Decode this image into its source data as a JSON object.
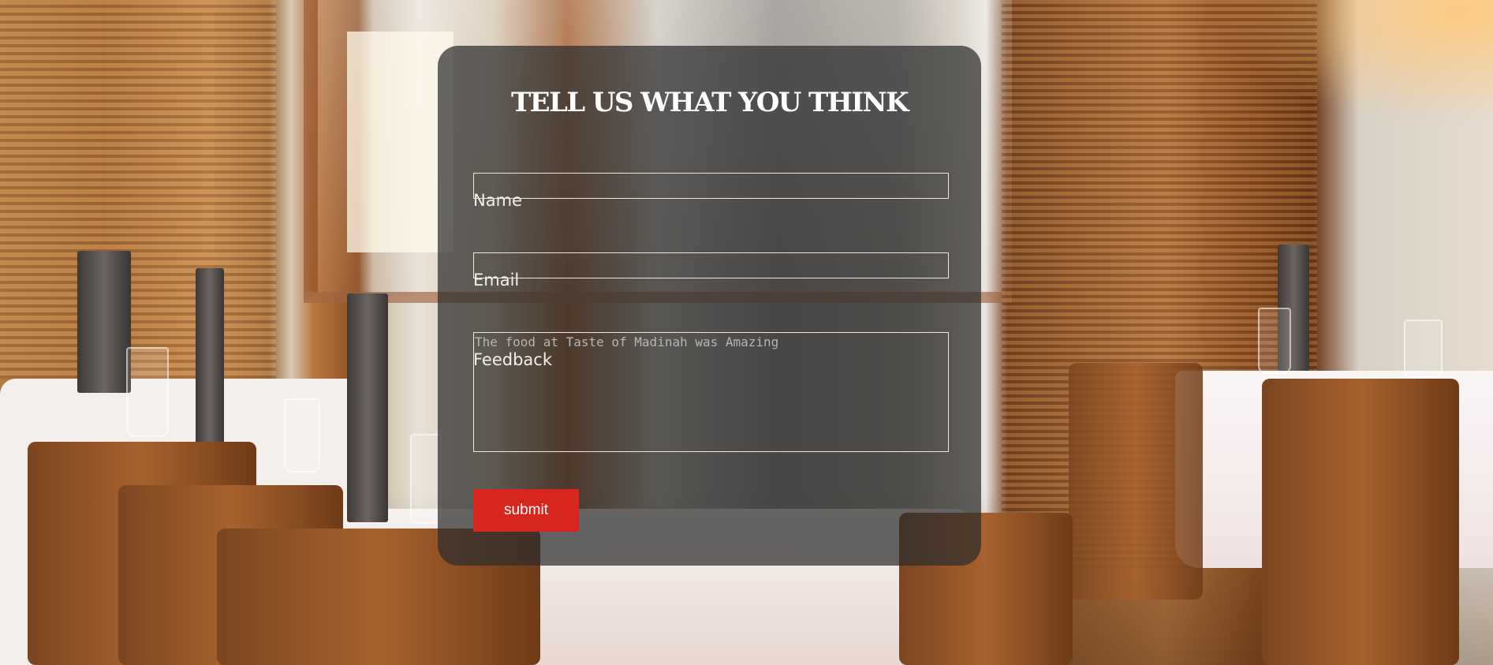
{
  "form": {
    "title": "TELL US WHAT YOU THINK",
    "name_label": "Name",
    "name_value": "",
    "email_label": "Email",
    "email_value": "",
    "feedback_label": "Feedback",
    "feedback_placeholder": "The food at Taste of Madinah was Amazing",
    "submit_label": "submit"
  },
  "colors": {
    "card_background": "#2d2d2d",
    "submit_button": "#d7261d",
    "field_border": "#efe8dc",
    "text": "#ffffff"
  }
}
